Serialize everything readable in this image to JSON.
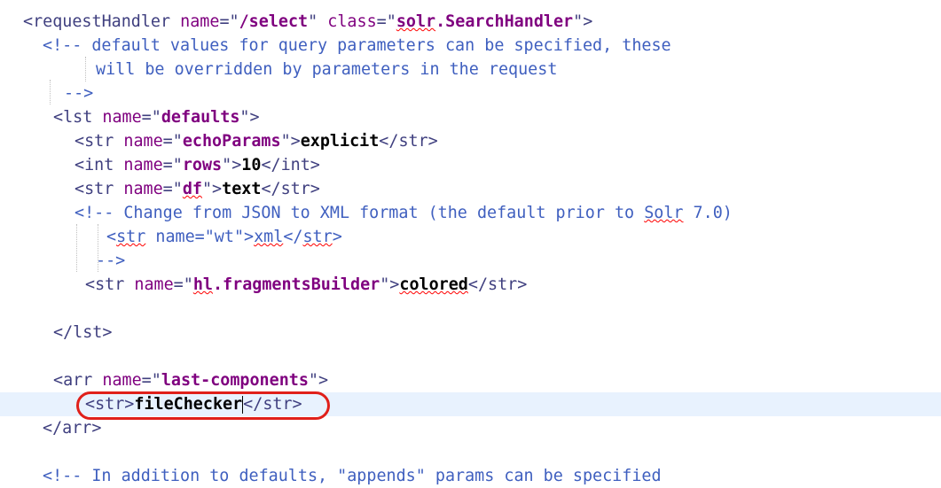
{
  "editor": {
    "lines": [
      {
        "parts": [
          {
            "t": "<requestHandler ",
            "c": "tag"
          },
          {
            "t": "name",
            "c": "attr"
          },
          {
            "t": "=\"",
            "c": "tag"
          },
          {
            "t": "/select",
            "c": "val-bold"
          },
          {
            "t": "\" ",
            "c": "tag"
          },
          {
            "t": "class",
            "c": "attr"
          },
          {
            "t": "=\"",
            "c": "tag"
          },
          {
            "t": "solr",
            "c": "val-bold squiggle"
          },
          {
            "t": ".SearchHandler",
            "c": "val-bold"
          },
          {
            "t": "\">",
            "c": "tag"
          }
        ]
      },
      {
        "parts": [
          {
            "t": "<!-- default values for query parameters can be specified, these",
            "c": "comment"
          }
        ]
      },
      {
        "parts": [
          {
            "t": "will be overridden by parameters in the request",
            "c": "comment"
          }
        ]
      },
      {
        "parts": [
          {
            "t": "-->",
            "c": "comment"
          }
        ]
      },
      {
        "parts": [
          {
            "t": "<lst ",
            "c": "tag"
          },
          {
            "t": "name",
            "c": "attr"
          },
          {
            "t": "=\"",
            "c": "tag"
          },
          {
            "t": "defaults",
            "c": "val-bold"
          },
          {
            "t": "\">",
            "c": "tag"
          }
        ]
      },
      {
        "parts": [
          {
            "t": "<str ",
            "c": "tag"
          },
          {
            "t": "name",
            "c": "attr"
          },
          {
            "t": "=\"",
            "c": "tag"
          },
          {
            "t": "echoParams",
            "c": "val-bold"
          },
          {
            "t": "\">",
            "c": "tag"
          },
          {
            "t": "explicit",
            "c": "content"
          },
          {
            "t": "</str>",
            "c": "tag"
          }
        ]
      },
      {
        "parts": [
          {
            "t": "<int ",
            "c": "tag"
          },
          {
            "t": "name",
            "c": "attr"
          },
          {
            "t": "=\"",
            "c": "tag"
          },
          {
            "t": "rows",
            "c": "val-bold"
          },
          {
            "t": "\">",
            "c": "tag"
          },
          {
            "t": "10",
            "c": "content"
          },
          {
            "t": "</int>",
            "c": "tag"
          }
        ]
      },
      {
        "parts": [
          {
            "t": "<str ",
            "c": "tag"
          },
          {
            "t": "name",
            "c": "attr"
          },
          {
            "t": "=\"",
            "c": "tag"
          },
          {
            "t": "df",
            "c": "val-bold squiggle"
          },
          {
            "t": "\">",
            "c": "tag"
          },
          {
            "t": "text",
            "c": "content"
          },
          {
            "t": "</str>",
            "c": "tag"
          }
        ]
      },
      {
        "parts": [
          {
            "t": "<!-- Change from JSON to XML format (the default prior to ",
            "c": "comment"
          },
          {
            "t": "Solr",
            "c": "comment squiggle"
          },
          {
            "t": " 7.0)",
            "c": "comment"
          }
        ]
      },
      {
        "parts": [
          {
            "t": "<",
            "c": "comment"
          },
          {
            "t": "str",
            "c": "comment squiggle"
          },
          {
            "t": " name=\"wt\">",
            "c": "comment"
          },
          {
            "t": "xml",
            "c": "comment squiggle"
          },
          {
            "t": "</",
            "c": "comment"
          },
          {
            "t": "str",
            "c": "comment squiggle"
          },
          {
            "t": ">",
            "c": "comment"
          }
        ]
      },
      {
        "parts": [
          {
            "t": "-->",
            "c": "comment"
          }
        ]
      },
      {
        "parts": [
          {
            "t": "<str ",
            "c": "tag"
          },
          {
            "t": "name",
            "c": "attr"
          },
          {
            "t": "=\"",
            "c": "tag"
          },
          {
            "t": "hl",
            "c": "val-bold squiggle"
          },
          {
            "t": ".fragmentsBuilder",
            "c": "val-bold"
          },
          {
            "t": "\">",
            "c": "tag"
          },
          {
            "t": "colored",
            "c": "content squiggle"
          },
          {
            "t": "</str>",
            "c": "tag"
          }
        ]
      },
      {
        "parts": []
      },
      {
        "parts": [
          {
            "t": "</lst>",
            "c": "tag"
          }
        ]
      },
      {
        "parts": []
      },
      {
        "parts": [
          {
            "t": "<arr ",
            "c": "tag"
          },
          {
            "t": "name",
            "c": "attr"
          },
          {
            "t": "=\"",
            "c": "tag"
          },
          {
            "t": "last-components",
            "c": "val-bold"
          },
          {
            "t": "\">",
            "c": "tag"
          }
        ]
      },
      {
        "parts": [
          {
            "t": "<str>",
            "c": "tag"
          },
          {
            "t": "fileChecker",
            "c": "content"
          },
          {
            "t": "|",
            "c": "caret"
          },
          {
            "t": "</str>",
            "c": "tag"
          }
        ]
      },
      {
        "parts": [
          {
            "t": "</arr>",
            "c": "tag"
          }
        ]
      },
      {
        "parts": []
      },
      {
        "parts": [
          {
            "t": "<!-- In addition to defaults, \"appends\" params can be specified",
            "c": "comment"
          }
        ]
      }
    ]
  }
}
